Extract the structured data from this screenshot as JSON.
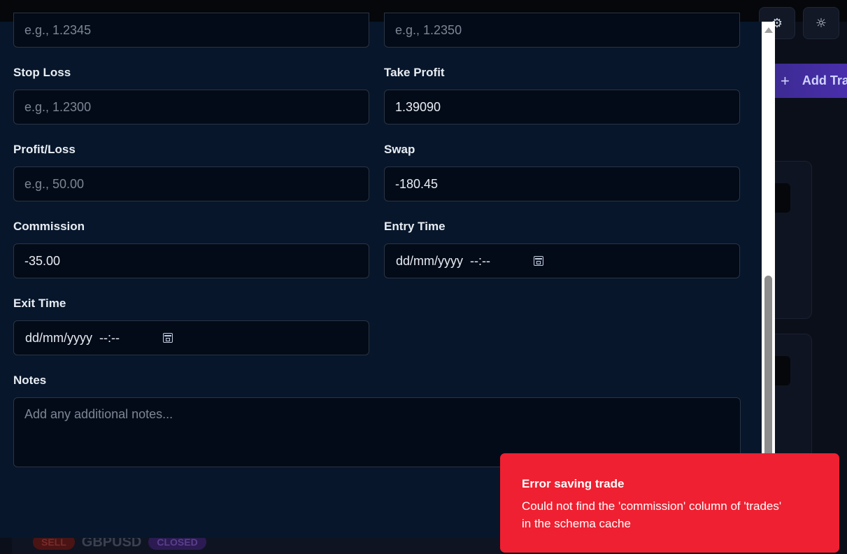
{
  "topbar": {
    "settings_icon": "gear-icon",
    "theme_icon": "sun-icon",
    "settings_glyph": "⚙",
    "theme_glyph": "☼"
  },
  "background": {
    "add_trade_label": "Add Tra",
    "add_trade_glyph": "+",
    "trade_row": {
      "side": "SELL",
      "symbol": "GBPUSD",
      "status": "CLOSED"
    }
  },
  "form": {
    "entry_price": {
      "placeholder": "e.g., 1.2345",
      "value": ""
    },
    "exit_price": {
      "placeholder": "e.g., 1.2350",
      "value": ""
    },
    "stop_loss": {
      "label": "Stop Loss",
      "placeholder": "e.g., 1.2300",
      "value": ""
    },
    "take_profit": {
      "label": "Take Profit",
      "placeholder": "",
      "value": "1.39090"
    },
    "profit_loss": {
      "label": "Profit/Loss",
      "placeholder": "e.g., 50.00",
      "value": ""
    },
    "swap": {
      "label": "Swap",
      "placeholder": "",
      "value": "-180.45"
    },
    "commission": {
      "label": "Commission",
      "placeholder": "",
      "value": "-35.00"
    },
    "entry_time": {
      "label": "Entry Time",
      "value": "dd/mm/yyyy  --:--"
    },
    "exit_time": {
      "label": "Exit Time",
      "value": "dd/mm/yyyy  --:--"
    },
    "notes": {
      "label": "Notes",
      "placeholder": "Add any additional notes..."
    }
  },
  "toast": {
    "title": "Error saving trade",
    "message": "Could not find the 'commission' column of 'trades' in the schema cache",
    "color": "#ef2031"
  }
}
